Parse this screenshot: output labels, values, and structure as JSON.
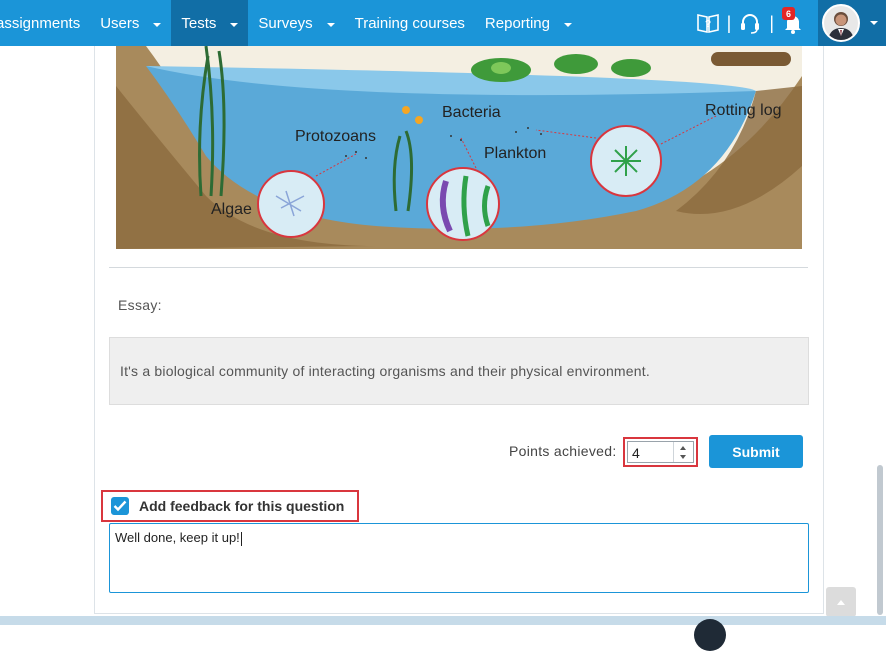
{
  "nav": {
    "items": [
      {
        "label": "assignments",
        "active": false,
        "caret": false
      },
      {
        "label": "Users",
        "active": false,
        "caret": true
      },
      {
        "label": "Tests",
        "active": true,
        "caret": true
      },
      {
        "label": "Surveys",
        "active": false,
        "caret": true
      },
      {
        "label": "Training courses",
        "active": false,
        "caret": false
      },
      {
        "label": "Reporting",
        "active": false,
        "caret": true
      }
    ],
    "notification_count": "6"
  },
  "illustration": {
    "labels": {
      "rotting_log": "Rotting log",
      "bacteria": "Bacteria",
      "protozoans": "Protozoans",
      "plankton": "Plankton",
      "algae": "Algae"
    }
  },
  "question": {
    "essay_label": "Essay:",
    "answer": "It's a biological community of interacting organisms and their physical environment."
  },
  "grading": {
    "points_label": "Points achieved:",
    "points_value": "4",
    "submit_label": "Submit"
  },
  "feedback": {
    "checkbox_label": "Add feedback for this question",
    "checked": true,
    "text": "Well done, keep it up!"
  },
  "colors": {
    "brand": "#1b95d8",
    "nav_active": "#116ea6",
    "highlight": "#d9363e"
  }
}
